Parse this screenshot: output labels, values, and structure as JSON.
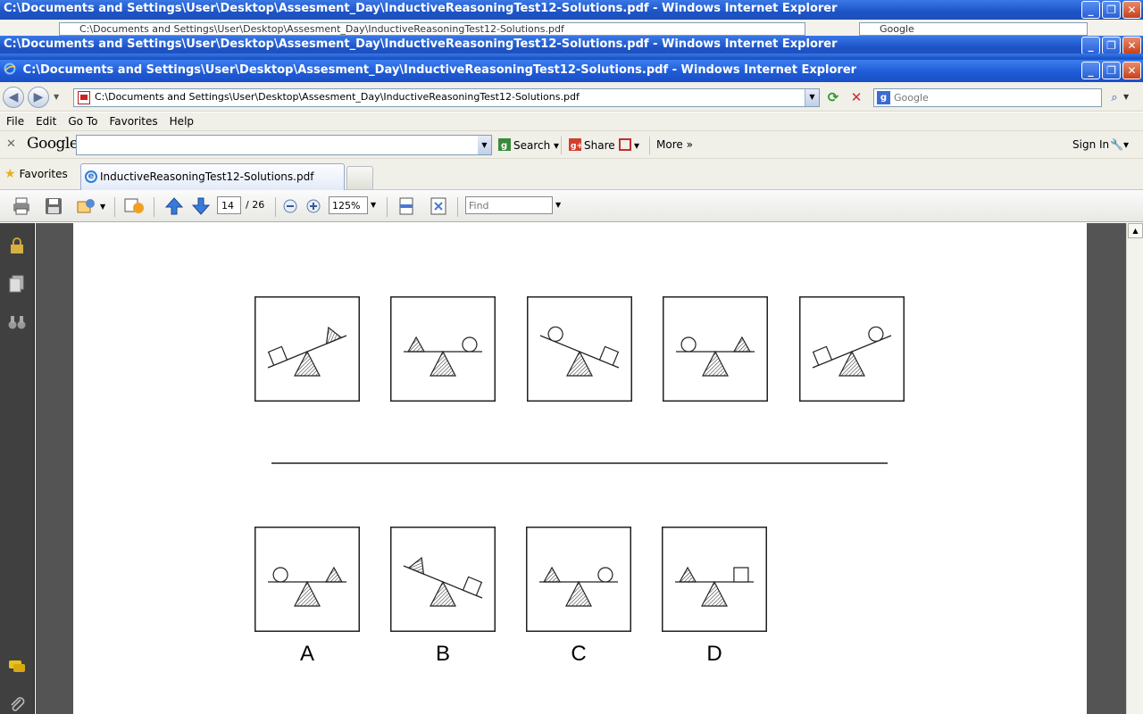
{
  "window": {
    "title": "C:\\Documents and Settings\\User\\Desktop\\Assesment_Day\\InductiveReasoningTest12-Solutions.pdf - Windows Internet Explorer"
  },
  "ghost_windows": [
    {
      "title": "C:\\Documents and Settings\\User\\Desktop\\Assesment_Day\\InductiveReasoningTest12-Solutions.pdf - Windows Internet Explorer",
      "address": "C:\\Documents and Settings\\User\\Desktop\\Assesment_Day\\InductiveReasoningTest12-Solutions.pdf",
      "search": "Google"
    },
    {
      "title": "C:\\Documents and Settings\\User\\Desktop\\Assesment_Day\\InductiveReasoningTest12-Solutions.pdf - Windows Internet Explorer"
    }
  ],
  "nav": {
    "back_icon": "back-arrow-icon",
    "forward_icon": "forward-arrow-icon",
    "address": "C:\\Documents and Settings\\User\\Desktop\\Assesment_Day\\InductiveReasoningTest12-Solutions.pdf",
    "search_placeholder": "Google"
  },
  "menu": [
    "File",
    "Edit",
    "Go To",
    "Favorites",
    "Help"
  ],
  "google_toolbar": {
    "logo": "Google",
    "search_label": "Search",
    "share_label": "Share",
    "more_label": "More »",
    "sign_in": "Sign In"
  },
  "tabs": {
    "favorites_label": "Favorites",
    "active_tab": "InductiveReasoningTest12-Solutions.pdf"
  },
  "pdf_toolbar": {
    "page_current": "14",
    "page_total": "/ 26",
    "zoom": "125%",
    "find_placeholder": "Find"
  },
  "puzzle": {
    "sequence": [
      {
        "left": "square",
        "right": "triangle",
        "tilt": "right-up"
      },
      {
        "left": "triangle",
        "right": "circle",
        "tilt": "level"
      },
      {
        "left": "circle",
        "right": "square",
        "tilt": "left-up"
      },
      {
        "left": "circle",
        "right": "triangle",
        "tilt": "level"
      },
      {
        "left": "square",
        "right": "circle",
        "tilt": "right-up"
      }
    ],
    "options": [
      {
        "label": "A",
        "left": "circle",
        "right": "triangle",
        "tilt": "level"
      },
      {
        "label": "B",
        "left": "triangle",
        "right": "square",
        "tilt": "left-up"
      },
      {
        "label": "C",
        "left": "triangle",
        "right": "circle",
        "tilt": "level"
      },
      {
        "label": "D",
        "left": "triangle",
        "right": "square",
        "tilt": "level"
      }
    ]
  },
  "colors": {
    "titlebar": "#1f5bd6",
    "chrome": "#f0efe8",
    "doc_background": "#545454",
    "nav_pane": "#404040"
  }
}
